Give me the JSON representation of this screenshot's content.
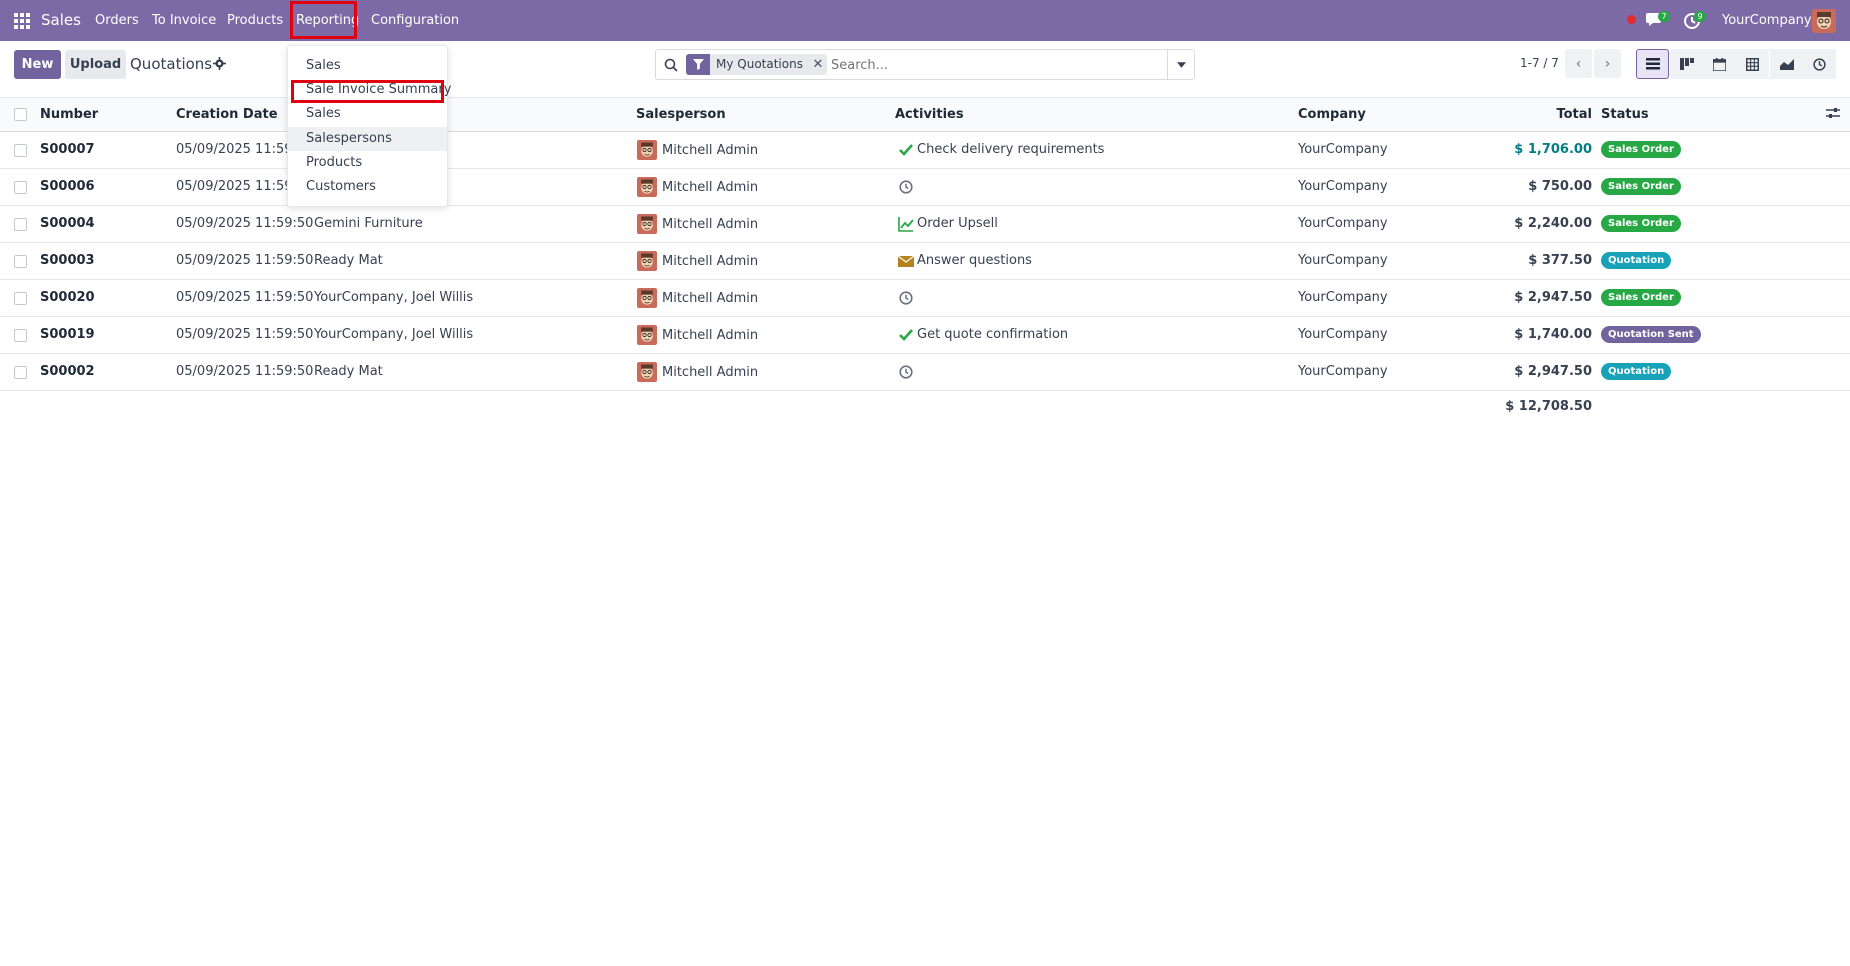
{
  "navbar": {
    "app_name": "Sales",
    "menu": [
      "Orders",
      "To Invoice",
      "Products",
      "Reporting",
      "Configuration"
    ],
    "chat_count": "7",
    "activity_count": "9",
    "company": "YourCompany"
  },
  "control": {
    "new_label": "New",
    "upload_label": "Upload",
    "title": "Quotations",
    "facet_label": "My Quotations",
    "search_placeholder": "Search...",
    "pager": "1-7 / 7"
  },
  "columns": {
    "number": "Number",
    "creation_date": "Creation Date",
    "salesperson": "Salesperson",
    "activities": "Activities",
    "company": "Company",
    "total": "Total",
    "status": "Status"
  },
  "rows": [
    {
      "number": "S00007",
      "date": "05/09/2025 11:59:5",
      "customer": "",
      "salesperson": "Mitchell Admin",
      "activity_icon": "check-icon",
      "activity": "Check delivery requirements",
      "company": "YourCompany",
      "total": "$ 1,706.00",
      "status": "Sales Order"
    },
    {
      "number": "S00006",
      "date": "05/09/2025 11:59:5",
      "customer": "",
      "salesperson": "Mitchell Admin",
      "activity_icon": "clock-icon",
      "activity": "",
      "company": "YourCompany",
      "total": "$ 750.00",
      "status": "Sales Order"
    },
    {
      "number": "S00004",
      "date": "05/09/2025 11:59:50",
      "customer": "Gemini Furniture",
      "salesperson": "Mitchell Admin",
      "activity_icon": "chart-line-icon",
      "activity": "Order Upsell",
      "company": "YourCompany",
      "total": "$ 2,240.00",
      "status": "Sales Order"
    },
    {
      "number": "S00003",
      "date": "05/09/2025 11:59:50",
      "customer": "Ready Mat",
      "salesperson": "Mitchell Admin",
      "activity_icon": "envelope-icon",
      "activity": "Answer questions",
      "company": "YourCompany",
      "total": "$ 377.50",
      "status": "Quotation"
    },
    {
      "number": "S00020",
      "date": "05/09/2025 11:59:50",
      "customer": "YourCompany, Joel Willis",
      "salesperson": "Mitchell Admin",
      "activity_icon": "clock-icon",
      "activity": "",
      "company": "YourCompany",
      "total": "$ 2,947.50",
      "status": "Sales Order"
    },
    {
      "number": "S00019",
      "date": "05/09/2025 11:59:50",
      "customer": "YourCompany, Joel Willis",
      "salesperson": "Mitchell Admin",
      "activity_icon": "check-icon",
      "activity": "Get quote confirmation",
      "company": "YourCompany",
      "total": "$ 1,740.00",
      "status": "Quotation Sent"
    },
    {
      "number": "S00002",
      "date": "05/09/2025 11:59:50",
      "customer": "Ready Mat",
      "salesperson": "Mitchell Admin",
      "activity_icon": "clock-icon",
      "activity": "",
      "company": "YourCompany",
      "total": "$ 2,947.50",
      "status": "Quotation"
    }
  ],
  "grand_total": "$ 12,708.50",
  "status_colors": {
    "Sales Order": "#28a745",
    "Quotation": "#17a2b8",
    "Quotation Sent": "#71639e"
  },
  "total_link_color": "#017e84",
  "dropdown": {
    "items": [
      "Sales",
      "Sale Invoice Summary",
      "Sales",
      "Salespersons",
      "Products",
      "Customers"
    ]
  }
}
